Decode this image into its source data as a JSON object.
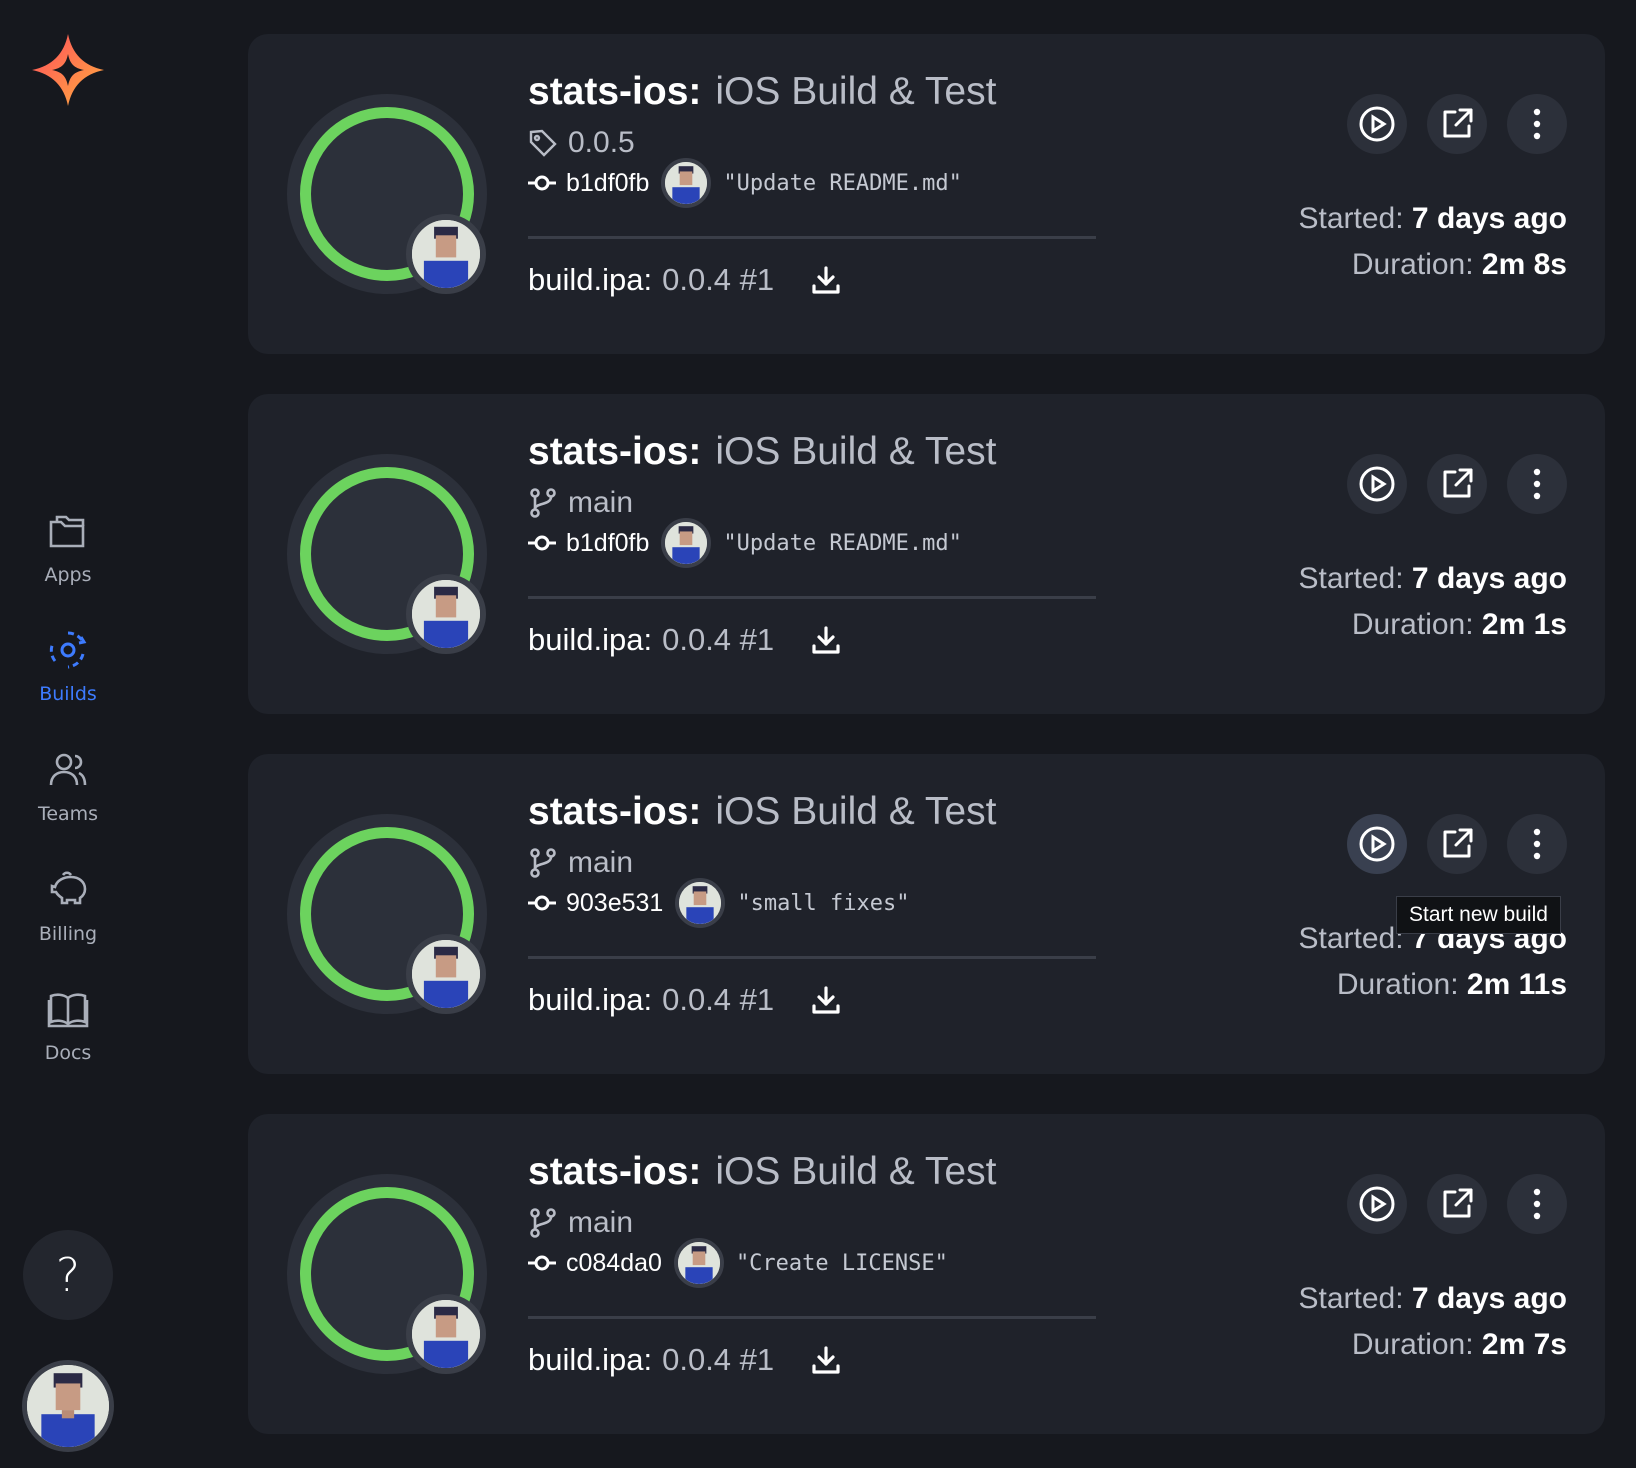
{
  "sidebar": {
    "items": [
      {
        "label": "Apps",
        "icon": "folder-icon",
        "active": false
      },
      {
        "label": "Builds",
        "icon": "builds-gear-icon",
        "active": true
      },
      {
        "label": "Teams",
        "icon": "teams-icon",
        "active": false
      },
      {
        "label": "Billing",
        "icon": "piggy-bank-icon",
        "active": false
      },
      {
        "label": "Docs",
        "icon": "book-icon",
        "active": false
      }
    ],
    "help_label": "?"
  },
  "colors": {
    "accent": "#3d7bff",
    "success": "#6cd35e",
    "card_bg": "#1f222a",
    "page_bg": "#16181e"
  },
  "builds": [
    {
      "repo": "stats-ios:",
      "workflow": "iOS Build & Test",
      "ref_type": "tag",
      "ref_icon": "tag-icon",
      "ref": "0.0.5",
      "sha": "b1df0fb",
      "message": "\"Update README.md\"",
      "artifact_name": "build.ipa:",
      "artifact_version": "0.0.4 #1",
      "started_label": "Started:",
      "started": "7 days ago",
      "duration_label": "Duration:",
      "duration": "2m 8s"
    },
    {
      "repo": "stats-ios:",
      "workflow": "iOS Build & Test",
      "ref_type": "branch",
      "ref_icon": "branch-icon",
      "ref": "main",
      "sha": "b1df0fb",
      "message": "\"Update README.md\"",
      "artifact_name": "build.ipa:",
      "artifact_version": "0.0.4 #1",
      "started_label": "Started:",
      "started": "7 days ago",
      "duration_label": "Duration:",
      "duration": "2m 1s"
    },
    {
      "repo": "stats-ios:",
      "workflow": "iOS Build & Test",
      "ref_type": "branch",
      "ref_icon": "branch-icon",
      "ref": "main",
      "sha": "903e531",
      "message": "\"small fixes\"",
      "artifact_name": "build.ipa:",
      "artifact_version": "0.0.4 #1",
      "started_label": "Started:",
      "started": "7 days ago",
      "duration_label": "Duration:",
      "duration": "2m 11s"
    },
    {
      "repo": "stats-ios:",
      "workflow": "iOS Build & Test",
      "ref_type": "branch",
      "ref_icon": "branch-icon",
      "ref": "main",
      "sha": "c084da0",
      "message": "\"Create LICENSE\"",
      "artifact_name": "build.ipa:",
      "artifact_version": "0.0.4 #1",
      "started_label": "Started:",
      "started": "7 days ago",
      "duration_label": "Duration:",
      "duration": "2m 7s"
    }
  ],
  "tooltip": {
    "text": "Start new build"
  }
}
